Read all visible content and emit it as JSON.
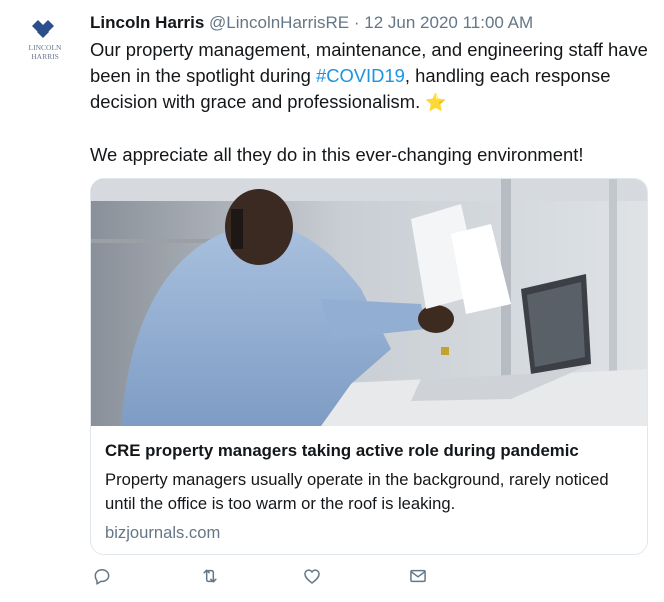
{
  "tweet": {
    "author_name": "Lincoln Harris",
    "handle": "@LincolnHarrisRE",
    "separator": "·",
    "timestamp": "12 Jun 2020 11:00 AM",
    "text_line1_before": "Our property management, maintenance, and engineering staff have been in the spotlight during ",
    "hashtag": "#COVID19",
    "text_line1_after": ", handling each response decision with grace and professionalism. ",
    "star_emoji": "⭐",
    "text_line2": "We appreciate all they do in this ever-changing environment!"
  },
  "avatar": {
    "logo_text_line1": "LINCOLN",
    "logo_text_line2": "HARRIS",
    "brand_color": "#2b4f8c"
  },
  "card": {
    "title": "CRE property managers taking active role during pandemic",
    "description": "Property managers usually operate in the background, rarely noticed until the office is too warm or the roof is leaking.",
    "domain": "bizjournals.com"
  },
  "actions": [
    {
      "icon": "reply-icon"
    },
    {
      "icon": "retweet-icon"
    },
    {
      "icon": "like-icon"
    },
    {
      "icon": "share-icon"
    }
  ],
  "colors": {
    "link": "#1b95e0",
    "muted": "#657786",
    "text": "#14171a",
    "border": "#e1e8ed"
  }
}
